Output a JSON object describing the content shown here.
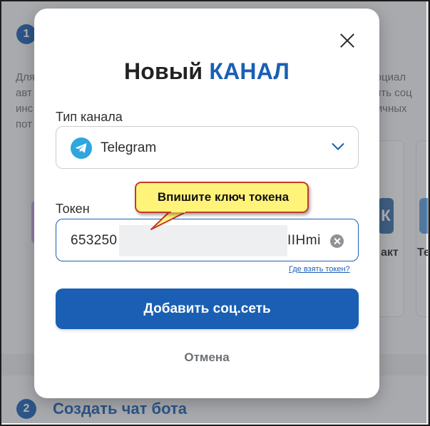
{
  "background": {
    "step1_number": "1",
    "left_text_lines": [
      "Для",
      "авт",
      "инс",
      "пот"
    ],
    "right_text_lines": [
      "социал",
      "зить соц",
      "личных"
    ],
    "vk_glyph": "К",
    "vk_label": "акт",
    "te_label": "Те",
    "step2_number": "2",
    "step2_label": "Создать чат бота"
  },
  "modal": {
    "title_part1": "Новый",
    "title_part2": "КАНАЛ",
    "channel_type_label": "Тип канала",
    "channel_type_value": "Telegram",
    "channel_type_icon": "telegram-icon",
    "token_label": "Токен",
    "token_value_start": "653250",
    "token_value_end": "IIHmi",
    "help_link": "Где взять токен?",
    "submit_label": "Добавить соц.сеть",
    "cancel_label": "Отмена"
  },
  "callout": {
    "text": "Впишите ключ токена"
  },
  "colors": {
    "accent": "#1a5fb4",
    "telegram": "#2ea6de",
    "callout_fill": "#fff37a",
    "callout_border": "#c43a2a"
  }
}
